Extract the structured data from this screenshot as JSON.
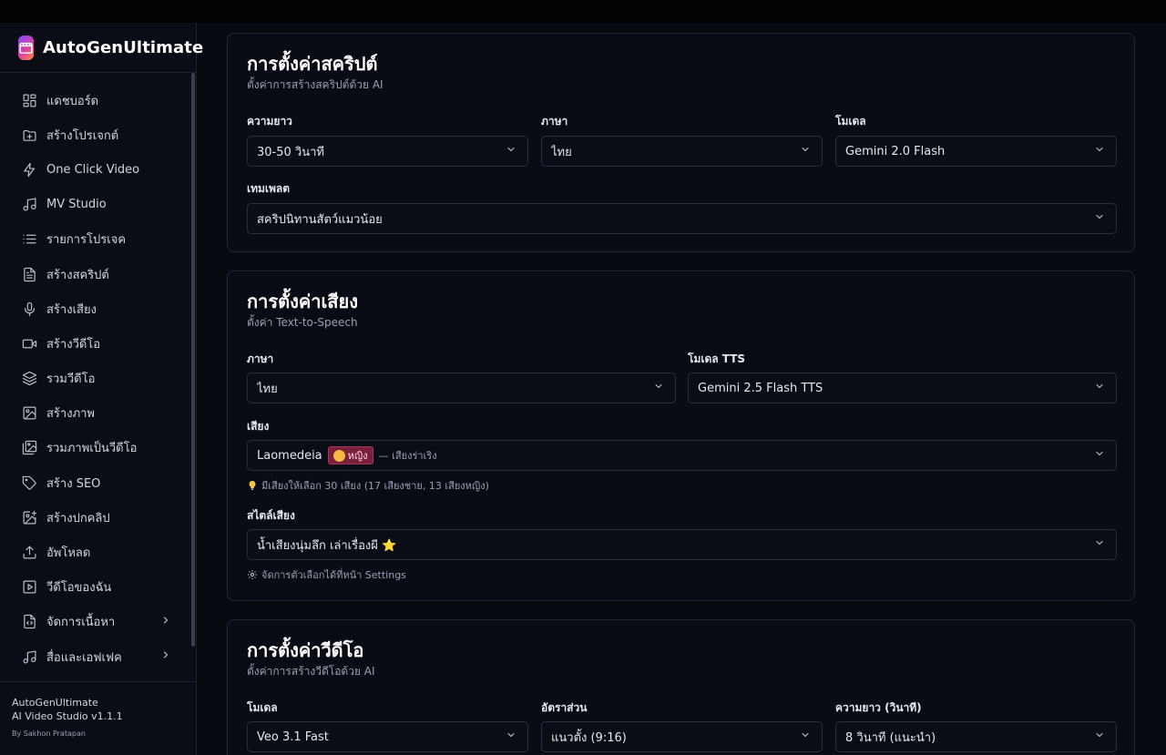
{
  "app": {
    "title": "AutoGenUltimate"
  },
  "sidebar": {
    "items": [
      {
        "label": "แดชบอร์ด",
        "icon": "dashboard-icon"
      },
      {
        "label": "สร้างโปรเจกต์",
        "icon": "folder-plus-icon"
      },
      {
        "label": "One Click Video",
        "icon": "lightning-icon"
      },
      {
        "label": "MV Studio",
        "icon": "music-note-icon"
      },
      {
        "label": "รายการโปรเจค",
        "icon": "list-icon"
      },
      {
        "label": "สร้างสคริปต์",
        "icon": "document-icon"
      },
      {
        "label": "สร้างเสียง",
        "icon": "microphone-icon"
      },
      {
        "label": "สร้างวีดีโอ",
        "icon": "video-camera-icon"
      },
      {
        "label": "รวมวีดีโอ",
        "icon": "layers-icon"
      },
      {
        "label": "สร้างภาพ",
        "icon": "image-icon"
      },
      {
        "label": "รวมภาพเป็นวีดีโอ",
        "icon": "images-icon"
      },
      {
        "label": "สร้าง SEO",
        "icon": "tag-icon"
      },
      {
        "label": "สร้างปกคลิป",
        "icon": "image-plus-icon"
      },
      {
        "label": "อัพโหลด",
        "icon": "upload-icon"
      },
      {
        "label": "วีดีโอของฉัน",
        "icon": "play-square-icon"
      },
      {
        "label": "จัดการเนื้อหา",
        "icon": "file-code-icon"
      },
      {
        "label": "สื่อและเอฟเฟค",
        "icon": "music-note-icon"
      }
    ],
    "footer": {
      "name": "AutoGenUltimate",
      "version": "AI Video Studio v1.1.1",
      "by": "By Sakhon Pratapan"
    }
  },
  "script_card": {
    "title": "การตั้งค่าสคริปต์",
    "subtitle": "ตั้งค่าการสร้างสคริปต์ด้วย AI",
    "length_label": "ความยาว",
    "length_value": "30-50 วินาที",
    "language_label": "ภาษา",
    "language_value": "ไทย",
    "model_label": "โมเดล",
    "model_value": "Gemini 2.0 Flash",
    "template_label": "เทมเพลต",
    "template_value": "สคริปนิทานสัตว์แมวน้อย"
  },
  "voice_card": {
    "title": "การตั้งค่าเสียง",
    "subtitle": "ตั้งค่า Text-to-Speech",
    "language_label": "ภาษา",
    "language_value": "ไทย",
    "tts_label": "โมเดล TTS",
    "tts_value": "Gemini 2.5 Flash TTS",
    "voice_label": "เสียง",
    "voice_name": "Laomedeia",
    "voice_badge": "หญิง",
    "voice_desc": "— เสียงร่าเริง",
    "voice_hint": "มีเสียงให้เลือก 30 เสียง (17 เสียงชาย, 13 เสียงหญิง)",
    "style_label": "สไตล์เสียง",
    "style_value": "น้ำเสียงนุ่มลึก เล่าเรื่องผี ⭐",
    "style_hint": "จัดการตัวเลือกได้ที่หน้า Settings"
  },
  "video_card": {
    "title": "การตั้งค่าวีดีโอ",
    "subtitle": "ตั้งค่าการสร้างวีดีโอด้วย AI",
    "model_label": "โมเดล",
    "model_value": "Veo 3.1 Fast",
    "ratio_label": "อัตราส่วน",
    "ratio_value": "แนวตั้ง (9:16)",
    "duration_label": "ความยาว (วินาที)",
    "duration_value": "8 วินาที (แนะนำ)"
  }
}
